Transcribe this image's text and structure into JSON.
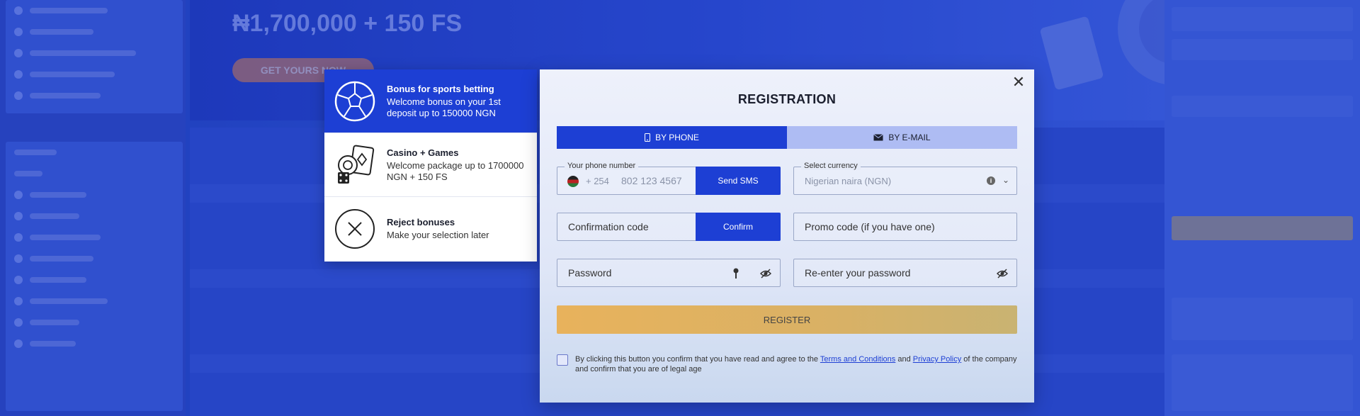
{
  "background": {
    "hero_title": "₦1,700,000 + 150 FS",
    "hero_button": "GET YOURS NOW"
  },
  "bonus_panel": {
    "items": [
      {
        "title": "Bonus for sports betting",
        "desc": "Welcome bonus on your 1st deposit up to 150000 NGN",
        "icon": "soccer-ball-icon",
        "active": true
      },
      {
        "title": "Casino + Games",
        "desc": "Welcome package up to 1700000 NGN + 150 FS",
        "icon": "casino-chips-icon",
        "active": false
      },
      {
        "title": "Reject bonuses",
        "desc": "Make your selection later",
        "icon": "close-circle-icon",
        "active": false
      }
    ]
  },
  "registration": {
    "title": "REGISTRATION",
    "tabs": {
      "phone": "BY PHONE",
      "email": "BY E-MAIL"
    },
    "phone": {
      "label": "Your phone number",
      "prefix": "+ 254",
      "placeholder": "802 123 4567",
      "send_sms": "Send SMS"
    },
    "currency": {
      "label": "Select currency",
      "value": "Nigerian naira (NGN)"
    },
    "confirmation": {
      "placeholder": "Confirmation code",
      "button": "Confirm"
    },
    "promo": {
      "placeholder": "Promo code (if you have one)"
    },
    "password": {
      "placeholder": "Password"
    },
    "repassword": {
      "placeholder": "Re-enter your password"
    },
    "register_button": "REGISTER",
    "consent": {
      "prefix": "By clicking this button you confirm that you have read and agree to the ",
      "terms": "Terms and Conditions",
      "and": " and ",
      "privacy": "Privacy Policy",
      "suffix": " of the company and confirm that you are of legal age"
    }
  },
  "colors": {
    "primary": "#1d3fd4",
    "register": "#e8b25c"
  }
}
